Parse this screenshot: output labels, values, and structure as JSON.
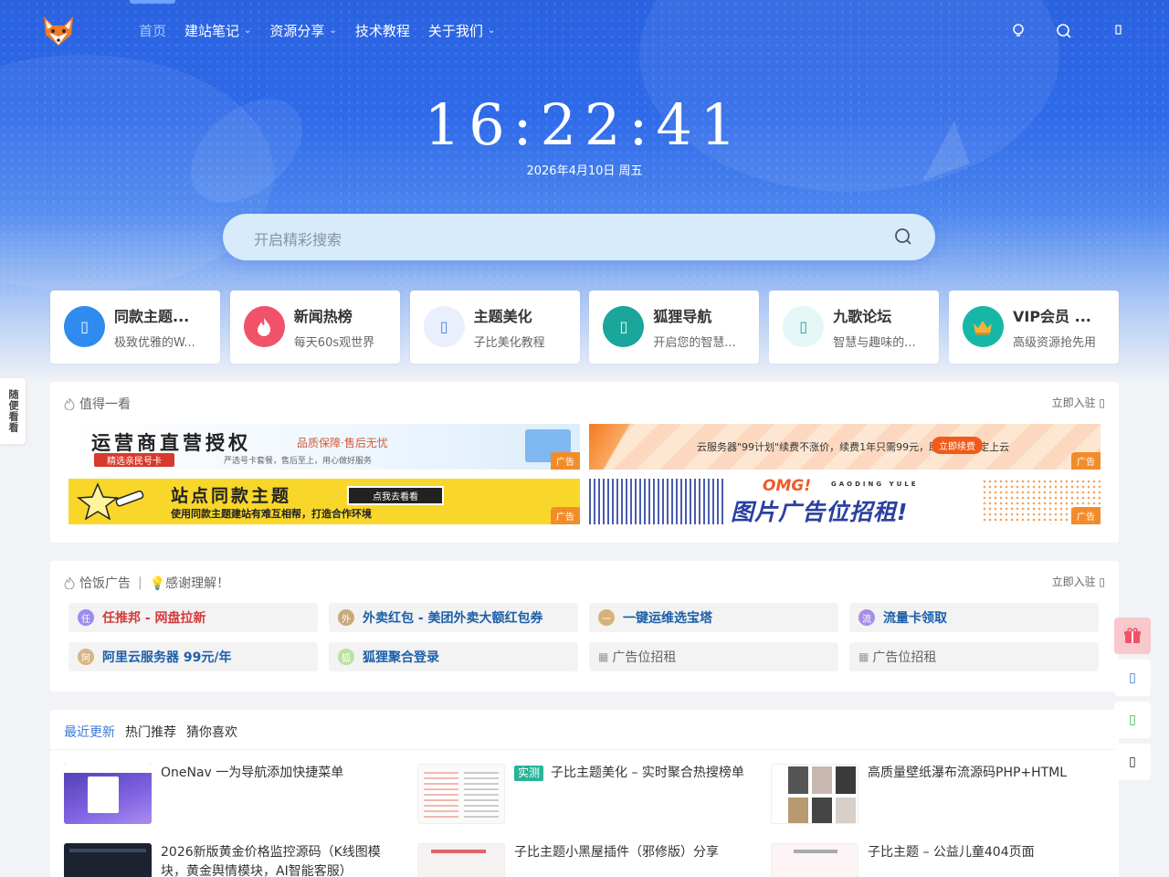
{
  "nav": {
    "items": [
      {
        "label": "首页",
        "caret": ""
      },
      {
        "label": "建站笔记",
        "caret": "⌄"
      },
      {
        "label": "资源分享",
        "caret": "⌄"
      },
      {
        "label": "技术教程",
        "caret": ""
      },
      {
        "label": "关于我们",
        "caret": "⌄"
      }
    ],
    "right_icons": [
      "lightbulb-icon",
      "search-icon",
      "user-icon"
    ]
  },
  "hero": {
    "clock": "16:22:41",
    "date": "2026年4月10日 周五",
    "search_placeholder": "开启精彩搜索"
  },
  "cards": [
    {
      "title": "同款主题...",
      "sub": "极致优雅的W...",
      "icon": "theme-icon",
      "color": "#2f8bf0"
    },
    {
      "title": "新闻热榜",
      "sub": "每天60s观世界",
      "icon": "fire-icon",
      "color": "#f0526a"
    },
    {
      "title": "主题美化",
      "sub": "子比美化教程",
      "icon": "brush-icon",
      "color": "#e9effc"
    },
    {
      "title": "狐狸导航",
      "sub": "开启您的智慧...",
      "icon": "compass-icon",
      "color": "#1aa69a"
    },
    {
      "title": "九歌论坛",
      "sub": "智慧与趣味的...",
      "icon": "forum-icon",
      "color": "#e5f6f6"
    },
    {
      "title": "VIP会员 ...",
      "sub": "高级资源抢先用",
      "icon": "crown-icon",
      "color": "#17b7a8"
    }
  ],
  "side_tab": "随便看看",
  "worth": {
    "title": "值得一看",
    "link": "立即入驻",
    "ad_tag": "广告",
    "ads": [
      {
        "headline": "运营商直营授权",
        "sub": "品质保障·售后无忧",
        "badge": "精选亲民号卡",
        "note": "严选号卡套餐，售后至上，用心做好服务"
      },
      {
        "headline": "云服务器\"99计划\"续费不涨价，续费1年只需99元，助力高效稳定上云",
        "btn": "立即续费"
      },
      {
        "headline": "站点同款主题",
        "btn": "点我去看看",
        "sub": "使用同款主题建站有难互相帮，打造合作环境"
      },
      {
        "headline": "图片广告位招租!",
        "sub": "OMG!",
        "note": "GAODING YULE"
      }
    ]
  },
  "meal": {
    "title": "恰饭广告",
    "divider": "|",
    "thanks": "💡感谢理解！",
    "link": "立即入驻",
    "links": [
      {
        "avatar": "任",
        "label": "任推邦 - 网盘拉新",
        "color": "#d43b3b",
        "avcolor": "#9c8cf0"
      },
      {
        "avatar": "外",
        "label": "外卖红包 - 美团外卖大额红包券",
        "color": "#1d5fa8",
        "avcolor": "#c9a97c"
      },
      {
        "avatar": "一",
        "label": "一键运维选宝塔",
        "color": "#1d5fa8",
        "avcolor": "#d6b27a"
      },
      {
        "avatar": "流",
        "label": "流量卡领取",
        "color": "#1d5fa8",
        "avcolor": "#a78ee8"
      },
      {
        "avatar": "阿",
        "label": "阿里云服务器 99元/年",
        "color": "#1d5fa8",
        "avcolor": "#d8b483"
      },
      {
        "avatar": "狐",
        "label": "狐狸聚合登录",
        "color": "#1d5fa8",
        "avcolor": "#b9e2a0"
      },
      {
        "avatar": "",
        "label": "广告位招租",
        "color": "#666666",
        "avcolor": ""
      },
      {
        "avatar": "",
        "label": "广告位招租",
        "color": "#666666",
        "avcolor": ""
      }
    ]
  },
  "recent": {
    "tabs": [
      "最近更新",
      "热门推荐",
      "猜你喜欢"
    ],
    "posts": [
      {
        "title": "OneNav 一为导航添加快捷菜单",
        "badge": ""
      },
      {
        "title": "子比主题美化 – 实时聚合热搜榜单",
        "badge": "实测"
      },
      {
        "title": "高质量壁纸瀑布流源码PHP+HTML",
        "badge": ""
      },
      {
        "title": "2026新版黄金价格监控源码（K线图模块，黄金舆情模块，AI智能客服）",
        "badge": ""
      },
      {
        "title": "子比主题小黑屋插件（邪修版）分享",
        "badge": ""
      },
      {
        "title": "子比主题 – 公益儿童404页面",
        "badge": ""
      }
    ]
  },
  "float_icons": [
    "gift-icon",
    "qq-icon",
    "wechat-icon",
    "phone-icon"
  ]
}
